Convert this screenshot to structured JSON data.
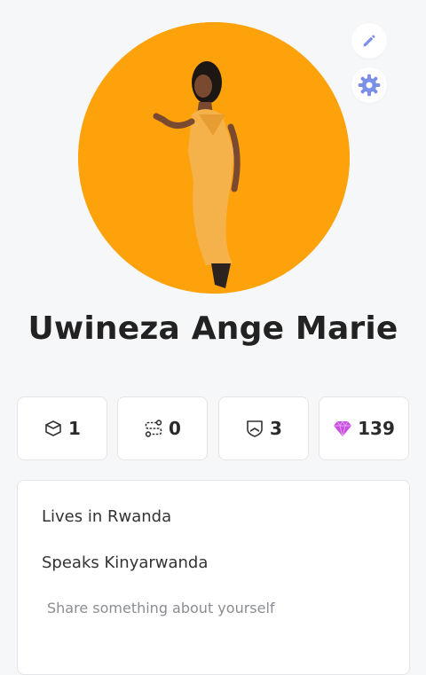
{
  "profile": {
    "name": "Uwineza Ange Marie",
    "avatar_bg": "#fea20c"
  },
  "actions": {
    "edit_icon": "pencil-icon",
    "settings_icon": "gear-icon",
    "accent": "#7b8fe8"
  },
  "stats": [
    {
      "icon": "hexagon-box-icon",
      "value": "1"
    },
    {
      "icon": "route-icon",
      "value": "0"
    },
    {
      "icon": "shield-icon",
      "value": "3"
    },
    {
      "icon": "gem-icon",
      "value": "139",
      "color": "#c84fe0"
    }
  ],
  "about": {
    "location": "Lives in Rwanda",
    "language": "Speaks Kinyarwanda",
    "bio_placeholder": "Share something about yourself"
  }
}
